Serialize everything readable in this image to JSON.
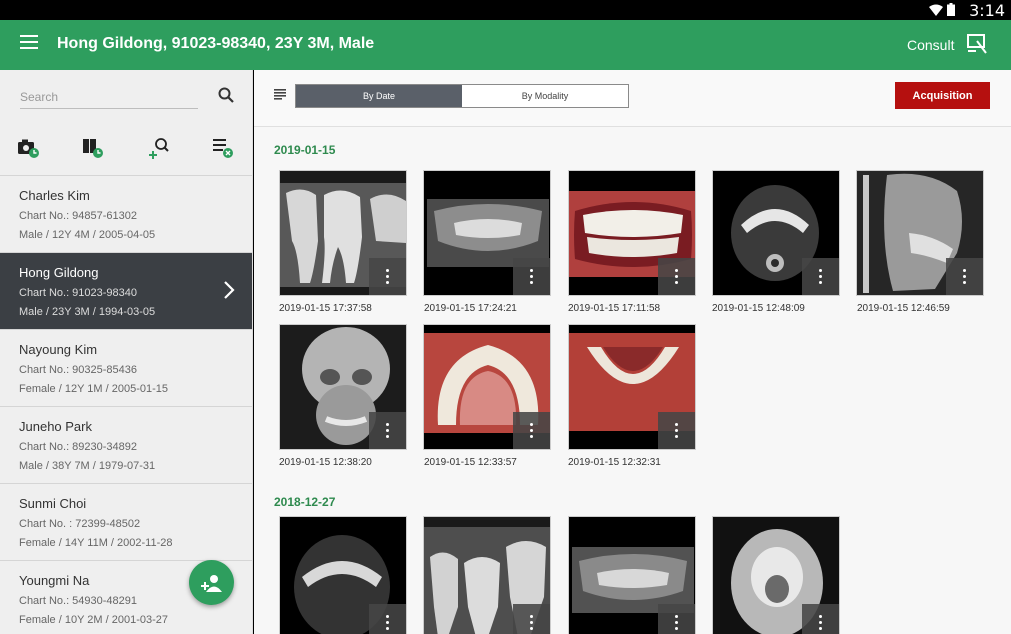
{
  "status_bar": {
    "time": "3:14"
  },
  "app_bar": {
    "title": "Hong Gildong, 91023-98340, 23Y 3M, Male",
    "consult_label": "Consult"
  },
  "sidebar": {
    "search_placeholder": "Search",
    "tools": [
      "camera-clock-icon",
      "book-clock-icon",
      "add-search-icon",
      "list-clear-icon"
    ],
    "patients": [
      {
        "name": "Charles Kim",
        "chart": "Chart No.: 94857-61302",
        "info": "Male / 12Y 4M / 2005-04-05"
      },
      {
        "name": "Hong Gildong",
        "chart": "Chart No.: 91023-98340",
        "info": "Male / 23Y 3M / 1994-03-05"
      },
      {
        "name": "Nayoung Kim",
        "chart": "Chart No.: 90325-85436",
        "info": "Female / 12Y 1M / 2005-01-15"
      },
      {
        "name": "Juneho Park",
        "chart": "Chart No.: 89230-34892",
        "info": "Male / 38Y 7M / 1979-07-31"
      },
      {
        "name": "Sunmi Choi",
        "chart": "Chart No. : 72399-48502",
        "info": "Female / 14Y 11M / 2002-11-28"
      },
      {
        "name": "Youngmi Na",
        "chart": "Chart No.: 54930-48291",
        "info": "Female / 10Y 2M / 2001-03-27"
      }
    ],
    "selected_index": 1
  },
  "toolbar": {
    "tabs": [
      {
        "label": "By Date",
        "active": true
      },
      {
        "label": "By Modality",
        "active": false
      }
    ],
    "acquisition_label": "Acquisition"
  },
  "colors": {
    "brand_green": "#2e9e5e",
    "acquisition_red": "#b5100f",
    "selected_row": "#3b3f44",
    "date_header": "#2e8a4e"
  },
  "groups": [
    {
      "date": "2019-01-15",
      "images": [
        {
          "kind": "bitewing-xray",
          "timestamp": "2019-01-15 17:37:58"
        },
        {
          "kind": "panoramic-xray",
          "timestamp": "2019-01-15 17:24:21"
        },
        {
          "kind": "intraoral-front-photo",
          "timestamp": "2019-01-15 17:11:58"
        },
        {
          "kind": "ct-axial-slice",
          "timestamp": "2019-01-15 12:48:09"
        },
        {
          "kind": "cephalometric-lateral",
          "timestamp": "2019-01-15 12:46:59"
        },
        {
          "kind": "cephalometric-pa",
          "timestamp": "2019-01-15 12:38:20"
        },
        {
          "kind": "intraoral-upper-occlusal-photo",
          "timestamp": "2019-01-15 12:33:57"
        },
        {
          "kind": "intraoral-lower-occlusal-photo",
          "timestamp": "2019-01-15 12:32:31"
        }
      ]
    },
    {
      "date": "2018-12-27",
      "images": [
        {
          "kind": "ct-axial-slice",
          "timestamp": ""
        },
        {
          "kind": "bitewing-xray",
          "timestamp": ""
        },
        {
          "kind": "panoramic-xray",
          "timestamp": ""
        },
        {
          "kind": "skull-submentovertex-xray",
          "timestamp": ""
        }
      ]
    }
  ]
}
